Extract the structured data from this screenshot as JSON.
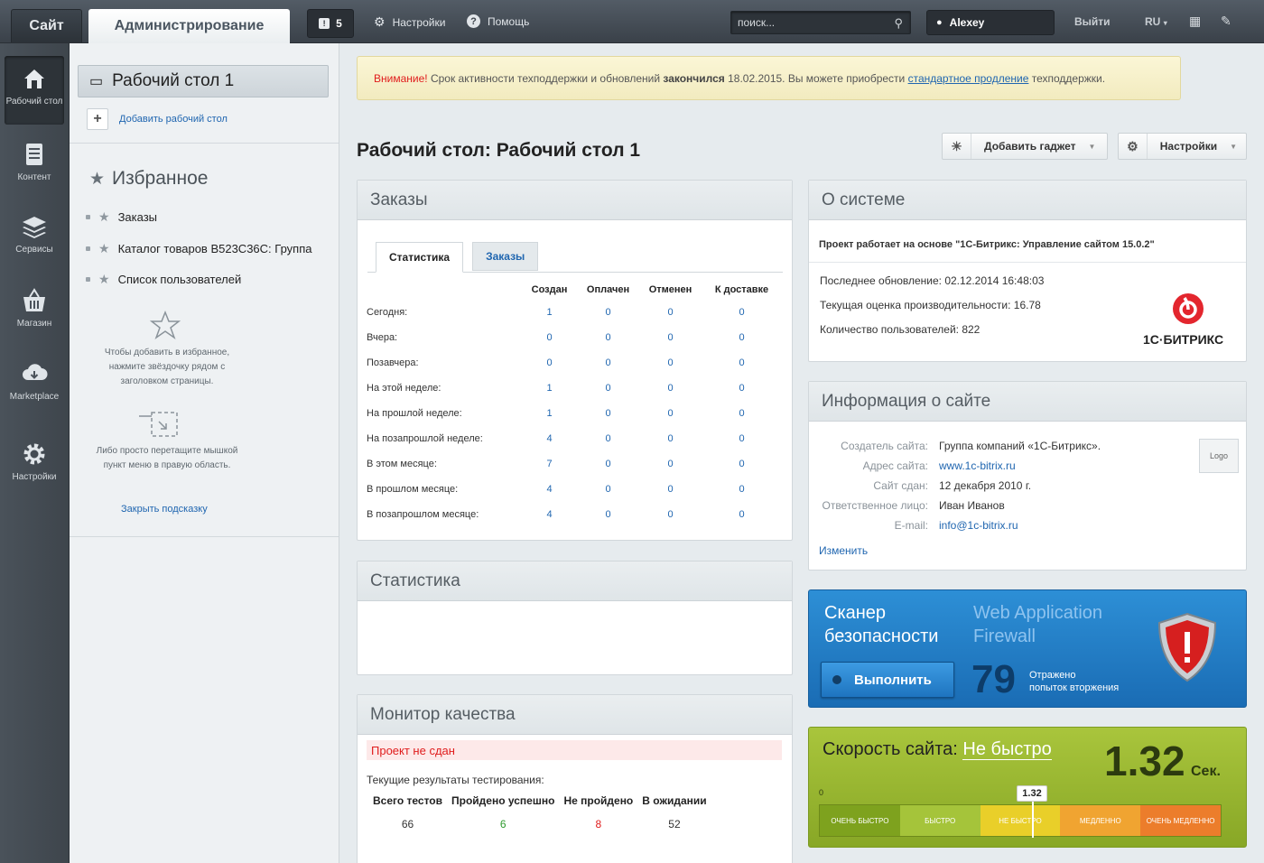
{
  "topbar": {
    "site_tab": "Сайт",
    "admin_tab": "Администрирование",
    "notifications_count": "5",
    "settings_label": "Настройки",
    "help_label": "Помощь",
    "search_placeholder": "поиск...",
    "user_name": "Alexey",
    "logout_label": "Выйти",
    "lang_label": "RU"
  },
  "nav": [
    {
      "label": "Рабочий стол",
      "icon": "home-icon"
    },
    {
      "label": "Контент",
      "icon": "document-icon"
    },
    {
      "label": "Сервисы",
      "icon": "layers-icon"
    },
    {
      "label": "Магазин",
      "icon": "basket-icon"
    },
    {
      "label": "Marketplace",
      "icon": "cloud-download-icon"
    },
    {
      "label": "Настройки",
      "icon": "gear-icon"
    }
  ],
  "leftpanel": {
    "desktop_label": "Рабочий стол 1",
    "add_desktop": "Добавить рабочий стол",
    "favorites_title": "Избранное",
    "favorites": [
      "Заказы",
      "Каталог товаров B523C36C: Группа",
      "Список пользователей"
    ],
    "hint1": "Чтобы добавить в избранное, нажмите звёздочку рядом с заголовком страницы.",
    "hint2": "Либо просто перетащите мышкой пункт меню в правую область.",
    "close_hint": "Закрыть подсказку"
  },
  "warning": {
    "attention": "Внимание!",
    "part1": " Срок активности техподдержки и обновлений ",
    "bold": "закончился",
    "part2": " 18.02.2015. Вы можете приобрести ",
    "link": "стандартное продление",
    "part3": " техподдержки."
  },
  "page": {
    "title": "Рабочий стол: Рабочий стол 1",
    "add_gadget": "Добавить гаджет",
    "settings": "Настройки"
  },
  "orders": {
    "title": "Заказы",
    "tabs": [
      "Статистика",
      "Заказы"
    ],
    "columns": [
      "Создан",
      "Оплачен",
      "Отменен",
      "К доставке"
    ],
    "rows": [
      {
        "label": "Сегодня:",
        "values": [
          "1",
          "0",
          "0",
          "0"
        ]
      },
      {
        "label": "Вчера:",
        "values": [
          "0",
          "0",
          "0",
          "0"
        ]
      },
      {
        "label": "Позавчера:",
        "values": [
          "0",
          "0",
          "0",
          "0"
        ]
      },
      {
        "label": "На этой неделе:",
        "values": [
          "1",
          "0",
          "0",
          "0"
        ]
      },
      {
        "label": "На прошлой неделе:",
        "values": [
          "1",
          "0",
          "0",
          "0"
        ]
      },
      {
        "label": "На позапрошлой неделе:",
        "values": [
          "4",
          "0",
          "0",
          "0"
        ]
      },
      {
        "label": "В этом месяце:",
        "values": [
          "7",
          "0",
          "0",
          "0"
        ]
      },
      {
        "label": "В прошлом месяце:",
        "values": [
          "4",
          "0",
          "0",
          "0"
        ]
      },
      {
        "label": "В позапрошлом месяце:",
        "values": [
          "4",
          "0",
          "0",
          "0"
        ]
      }
    ]
  },
  "stats": {
    "title": "Статистика"
  },
  "quality": {
    "title": "Монитор качества",
    "status": "Проект не сдан",
    "subtitle": "Текущие результаты тестирования:",
    "headers": [
      "Всего тестов",
      "Пройдено успешно",
      "Не пройдено",
      "В ожидании"
    ],
    "values": [
      "66",
      "6",
      "8",
      "52"
    ]
  },
  "system": {
    "title": "О системе",
    "project": "Проект работает на основе \"1С-Битрикс: Управление сайтом 15.0.2\"",
    "last_update": "Последнее обновление: 02.12.2014 16:48:03",
    "perf": "Текущая оценка производительности: 16.78",
    "users": "Количество пользователей: 822",
    "logo_text": "1С·БИТРИКС"
  },
  "siteinfo": {
    "title": "Информация о сайте",
    "rows": [
      {
        "k": "Создатель сайта:",
        "v": "Группа компаний «1С-Битрикс»."
      },
      {
        "k": "Адрес сайта:",
        "v": "www.1c-bitrix.ru"
      },
      {
        "k": "Сайт сдан:",
        "v": "12 декабря 2010 г."
      },
      {
        "k": "Ответственное лицо:",
        "v": "Иван Иванов"
      },
      {
        "k": "E-mail:",
        "v": "info@1c-bitrix.ru"
      }
    ],
    "logo": "Logo",
    "edit": "Изменить"
  },
  "scanner": {
    "title_line1": "Сканер",
    "title_line2": "безопасности",
    "waf_line1": "Web Application",
    "waf_line2": "Firewall",
    "run": "Выполнить",
    "count": "79",
    "attacks_line1": "Отражено",
    "attacks_line2": "попыток вторжения"
  },
  "speed": {
    "label": "Скорость сайта:",
    "status": "Не быстро",
    "value": "1.32",
    "unit": "Сек.",
    "marker": "1.32",
    "marker_zero": "0",
    "scale": [
      "ОЧЕНЬ БЫСТРО",
      "БЫСТРО",
      "НЕ БЫСТРО",
      "МЕДЛЕННО",
      "ОЧЕНЬ МЕДЛЕННО"
    ]
  },
  "colors": {
    "accent": "#2066b0",
    "warning_red": "#e01c1c",
    "scanner_blue": "#1a6cb4",
    "speed_green": "#9ab832"
  }
}
